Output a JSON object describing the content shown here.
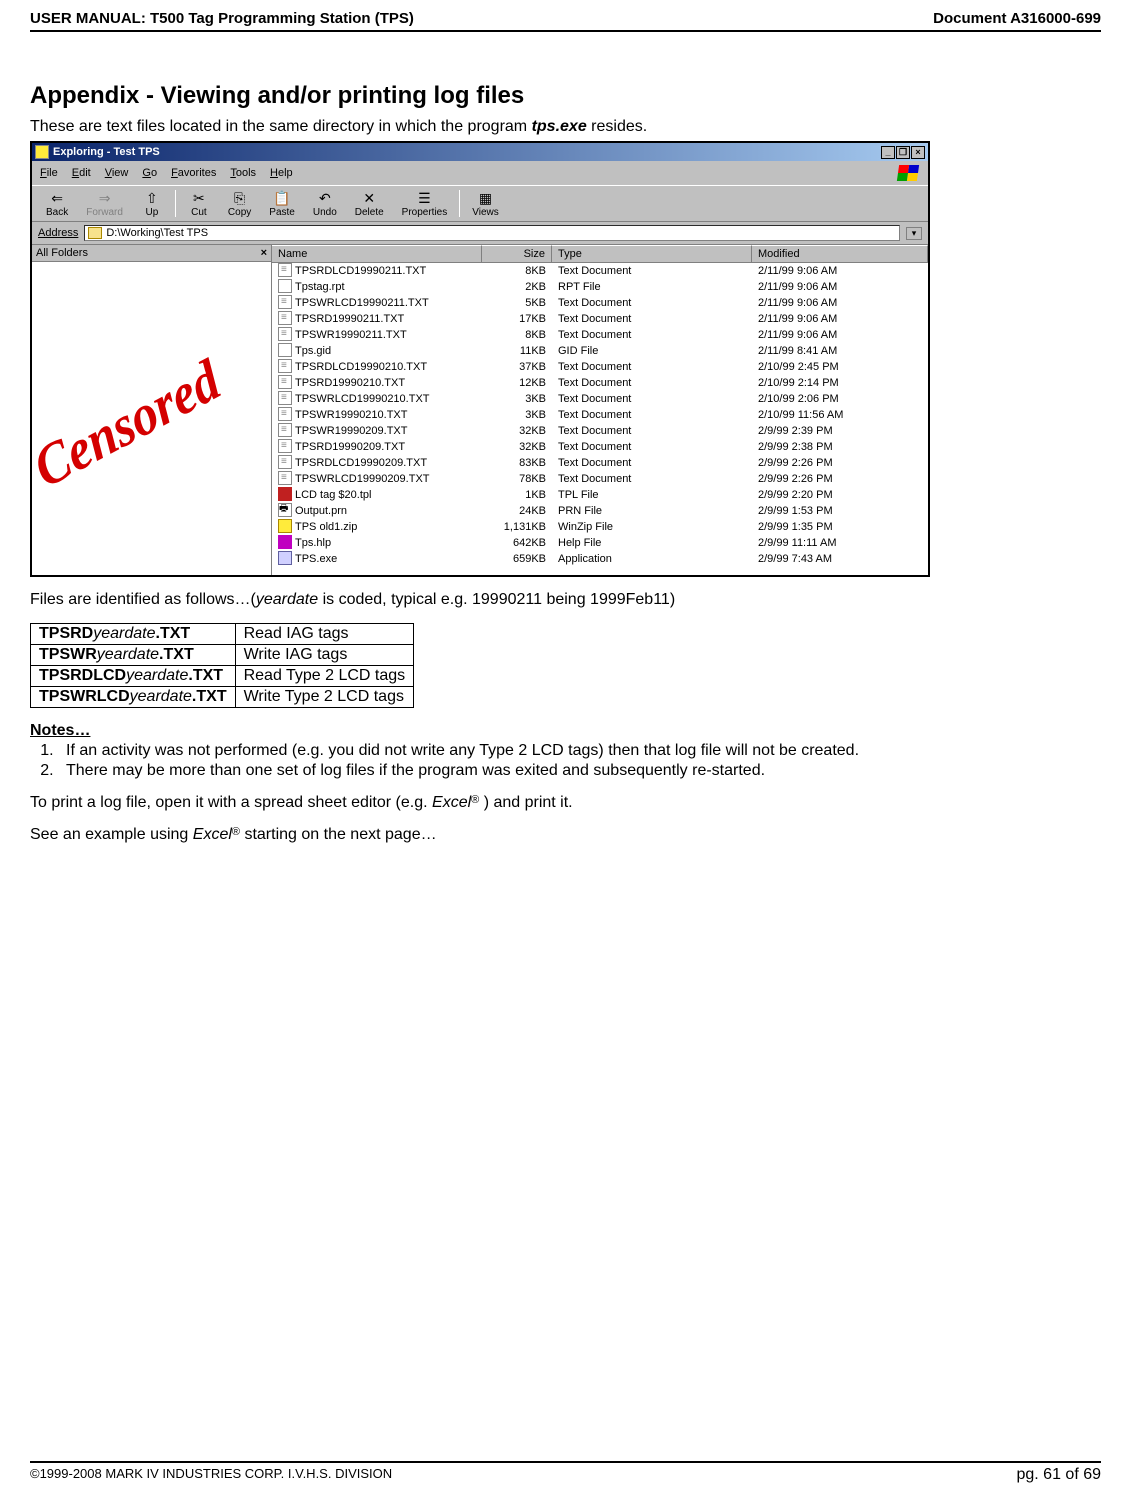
{
  "header": {
    "left": "USER MANUAL: T500 Tag Programming Station (TPS)",
    "right": "Document A316000-699"
  },
  "title": "Appendix - Viewing and/or printing log files",
  "intro_pre": "These are text files located in the same directory in which the program ",
  "intro_file": "tps.exe",
  "intro_post": " resides.",
  "explorer": {
    "title_pre": "Exploring - ",
    "title": "Test TPS",
    "win_min": "_",
    "win_max": "❐",
    "win_close": "×",
    "menus": [
      "File",
      "Edit",
      "View",
      "Go",
      "Favorites",
      "Tools",
      "Help"
    ],
    "toolbar": [
      {
        "label": "Back",
        "icon": "⇐",
        "dim": false
      },
      {
        "label": "Forward",
        "icon": "⇒",
        "dim": true
      },
      {
        "label": "Up",
        "icon": "⇧",
        "dim": false
      },
      {
        "label": "Cut",
        "icon": "✂",
        "dim": false
      },
      {
        "label": "Copy",
        "icon": "⎘",
        "dim": false
      },
      {
        "label": "Paste",
        "icon": "📋",
        "dim": false
      },
      {
        "label": "Undo",
        "icon": "↶",
        "dim": false
      },
      {
        "label": "Delete",
        "icon": "✕",
        "dim": false
      },
      {
        "label": "Properties",
        "icon": "☰",
        "dim": false
      },
      {
        "label": "Views",
        "icon": "▦",
        "dim": false
      }
    ],
    "address_label": "Address",
    "address_value": "D:\\Working\\Test TPS",
    "left_header": "All Folders",
    "left_x": "×",
    "censored": "Censored",
    "cols": {
      "name": "Name",
      "size": "Size",
      "type": "Type",
      "modified": "Modified"
    },
    "rows": [
      {
        "ico": "txt",
        "name": "TPSRDLCD19990211.TXT",
        "size": "8KB",
        "type": "Text Document",
        "mod": "2/11/99 9:06 AM"
      },
      {
        "ico": "rpt",
        "name": "Tpstag.rpt",
        "size": "2KB",
        "type": "RPT File",
        "mod": "2/11/99 9:06 AM"
      },
      {
        "ico": "txt",
        "name": "TPSWRLCD19990211.TXT",
        "size": "5KB",
        "type": "Text Document",
        "mod": "2/11/99 9:06 AM"
      },
      {
        "ico": "txt",
        "name": "TPSRD19990211.TXT",
        "size": "17KB",
        "type": "Text Document",
        "mod": "2/11/99 9:06 AM"
      },
      {
        "ico": "txt",
        "name": "TPSWR19990211.TXT",
        "size": "8KB",
        "type": "Text Document",
        "mod": "2/11/99 9:06 AM"
      },
      {
        "ico": "gid",
        "name": "Tps.gid",
        "size": "11KB",
        "type": "GID File",
        "mod": "2/11/99 8:41 AM"
      },
      {
        "ico": "txt",
        "name": "TPSRDLCD19990210.TXT",
        "size": "37KB",
        "type": "Text Document",
        "mod": "2/10/99 2:45 PM"
      },
      {
        "ico": "txt",
        "name": "TPSRD19990210.TXT",
        "size": "12KB",
        "type": "Text Document",
        "mod": "2/10/99 2:14 PM"
      },
      {
        "ico": "txt",
        "name": "TPSWRLCD19990210.TXT",
        "size": "3KB",
        "type": "Text Document",
        "mod": "2/10/99 2:06 PM"
      },
      {
        "ico": "txt",
        "name": "TPSWR19990210.TXT",
        "size": "3KB",
        "type": "Text Document",
        "mod": "2/10/99 11:56 AM"
      },
      {
        "ico": "txt",
        "name": "TPSWR19990209.TXT",
        "size": "32KB",
        "type": "Text Document",
        "mod": "2/9/99 2:39 PM"
      },
      {
        "ico": "txt",
        "name": "TPSRD19990209.TXT",
        "size": "32KB",
        "type": "Text Document",
        "mod": "2/9/99 2:38 PM"
      },
      {
        "ico": "txt",
        "name": "TPSRDLCD19990209.TXT",
        "size": "83KB",
        "type": "Text Document",
        "mod": "2/9/99 2:26 PM"
      },
      {
        "ico": "txt",
        "name": "TPSWRLCD19990209.TXT",
        "size": "78KB",
        "type": "Text Document",
        "mod": "2/9/99 2:26 PM"
      },
      {
        "ico": "tpl",
        "name": "LCD tag $20.tpl",
        "size": "1KB",
        "type": "TPL File",
        "mod": "2/9/99 2:20 PM"
      },
      {
        "ico": "prn",
        "name": "Output.prn",
        "size": "24KB",
        "type": "PRN File",
        "mod": "2/9/99 1:53 PM"
      },
      {
        "ico": "zip",
        "name": "TPS old1.zip",
        "size": "1,131KB",
        "type": "WinZip File",
        "mod": "2/9/99 1:35 PM"
      },
      {
        "ico": "hlp",
        "name": "Tps.hlp",
        "size": "642KB",
        "type": "Help File",
        "mod": "2/9/99 11:11 AM"
      },
      {
        "ico": "exe",
        "name": "TPS.exe",
        "size": "659KB",
        "type": "Application",
        "mod": "2/9/99 7:43 AM"
      }
    ]
  },
  "files_identify_pre": "Files are identified as follows…(",
  "files_identify_yd": "yeardate",
  "files_identify_post": " is coded, typical e.g. 19990211 being 1999Feb11)",
  "deftable": [
    {
      "p1": "TPSRD",
      "yd": "yeardate",
      "p2": ".TXT",
      "desc": "Read IAG tags"
    },
    {
      "p1": "TPSWR",
      "yd": "yeardate",
      "p2": ".TXT",
      "desc": "Write IAG tags"
    },
    {
      "p1": "TPSRDLCD",
      "yd": "yeardate",
      "p2": ".TXT",
      "desc": "Read Type 2 LCD tags"
    },
    {
      "p1": "TPSWRLCD",
      "yd": "yeardate",
      "p2": ".TXT",
      "desc": "Write Type 2 LCD tags"
    }
  ],
  "notes_head": "Notes…",
  "notes": [
    "If an activity was not performed (e.g. you did not write any Type 2 LCD tags) then that log file will not be created.",
    "There may be more than one set of log files if the program was exited and subsequently re-started."
  ],
  "print_para_pre": "To print a log file, open it with a spread sheet editor (e.g. ",
  "print_para_app": "Excel",
  "print_para_reg": "®",
  "print_para_post": " ) and print it.",
  "example_pre": "See an example using ",
  "example_app": "Excel",
  "example_reg": "®",
  "example_post": " starting on the next page…",
  "footer": {
    "left": "©1999-2008 MARK IV INDUSTRIES CORP. I.V.H.S. DIVISION",
    "right": "pg. 61 of 69"
  }
}
